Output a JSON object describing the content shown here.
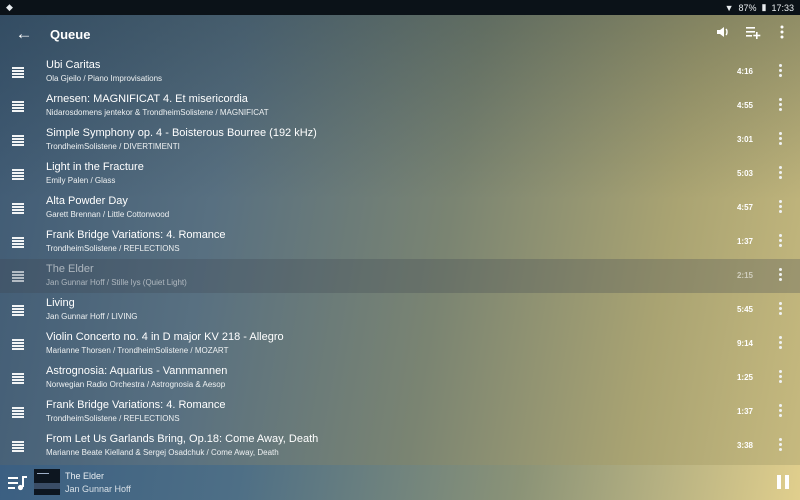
{
  "status": {
    "battery": "87%",
    "time": "17:33"
  },
  "toolbar": {
    "title": "Queue"
  },
  "queue": [
    {
      "title": "Ubi Caritas",
      "subtitle": "Ola Gjeilo / Piano Improvisations",
      "duration": "4:16"
    },
    {
      "title": "Arnesen: MAGNIFICAT 4. Et misericordia",
      "subtitle": "Nidarosdomens jentekor & TrondheimSolistene / MAGNIFICAT",
      "duration": "4:55"
    },
    {
      "title": "Simple Symphony  op. 4 - Boisterous Bourree (192 kHz)",
      "subtitle": "TrondheimSolistene / DIVERTIMENTI",
      "duration": "3:01"
    },
    {
      "title": "Light in the Fracture",
      "subtitle": "Emily Palen / Glass",
      "duration": "5:03"
    },
    {
      "title": "Alta Powder Day",
      "subtitle": "Garett Brennan / Little Cottonwood",
      "duration": "4:57"
    },
    {
      "title": "Frank Bridge Variations: 4. Romance",
      "subtitle": "TrondheimSolistene / REFLECTIONS",
      "duration": "1:37"
    },
    {
      "title": "The Elder",
      "subtitle": "Jan Gunnar Hoff / Stille lys (Quiet Light)",
      "duration": "2:15",
      "current": true
    },
    {
      "title": "Living",
      "subtitle": "Jan Gunnar Hoff / LIVING",
      "duration": "5:45"
    },
    {
      "title": "Violin Concerto no. 4 in D major KV 218 - Allegro",
      "subtitle": "Marianne Thorsen / TrondheimSolistene / MOZART",
      "duration": "9:14"
    },
    {
      "title": "Astrognosia: Aquarius - Vannmannen",
      "subtitle": "Norwegian Radio Orchestra / Astrognosia & Aesop",
      "duration": "1:25"
    },
    {
      "title": "Frank Bridge Variations: 4. Romance",
      "subtitle": "TrondheimSolistene / REFLECTIONS",
      "duration": "1:37"
    },
    {
      "title": "From Let Us Garlands Bring, Op.18: Come Away, Death",
      "subtitle": "Marianne Beate Kielland & Sergej Osadchuk / Come Away, Death",
      "duration": "3:38"
    }
  ],
  "now_playing": {
    "title": "The Elder",
    "artist": "Jan Gunnar Hoff"
  }
}
